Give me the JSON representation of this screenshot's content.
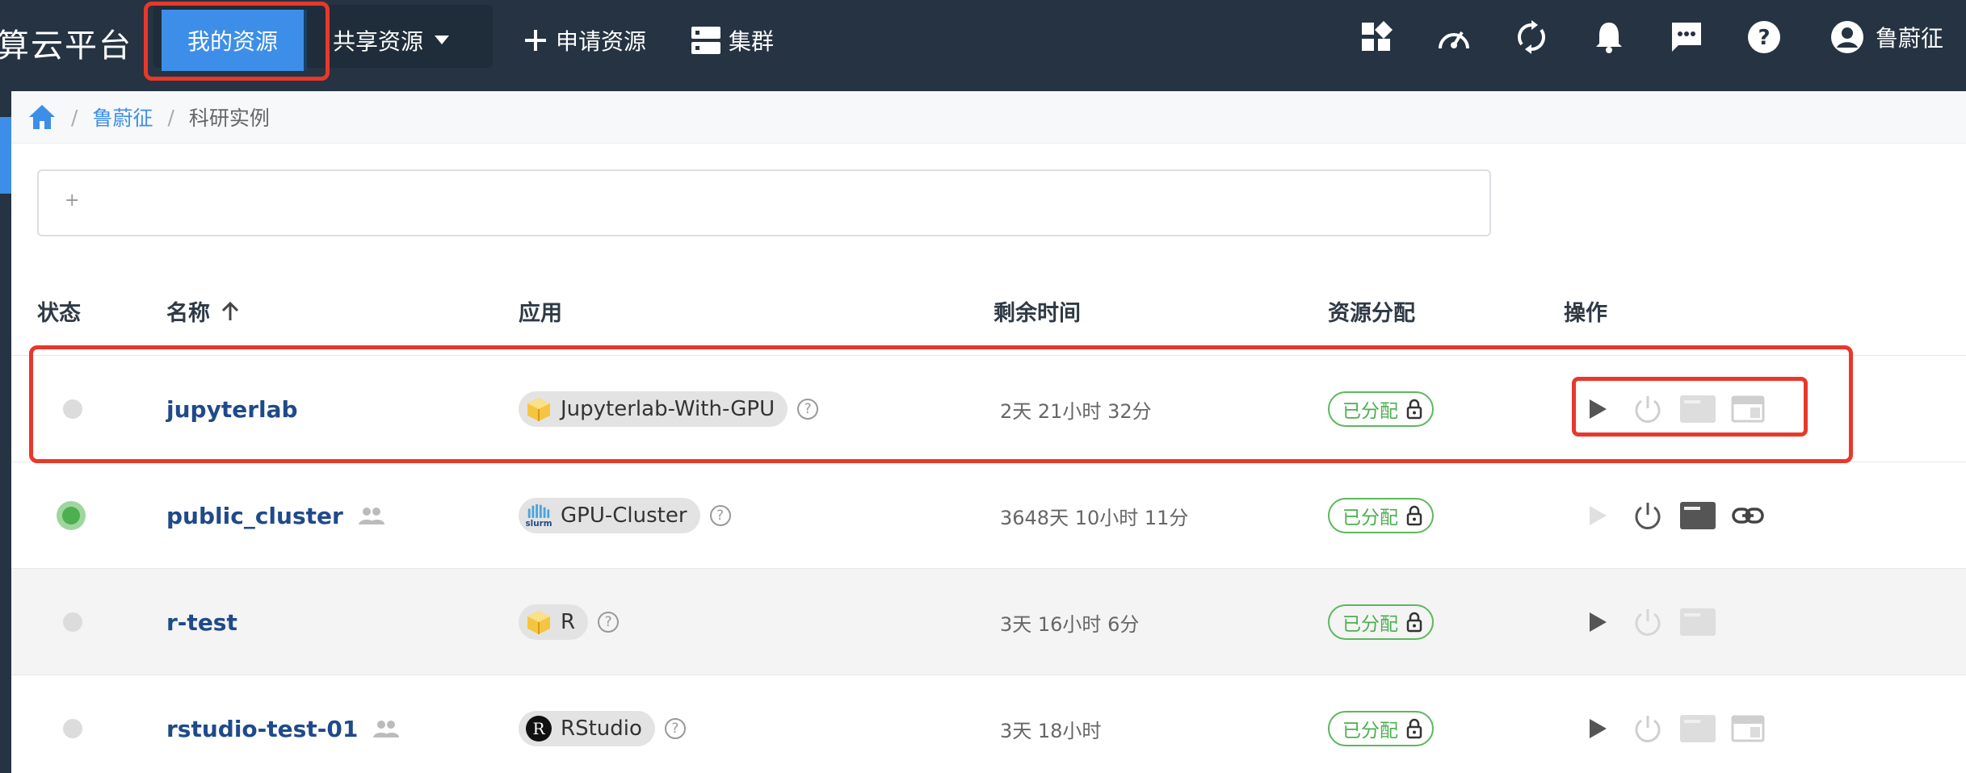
{
  "header": {
    "brand": "算云平台",
    "nav": {
      "my_resources": "我的资源",
      "shared_resources": "共享资源",
      "apply_resources": "申请资源",
      "cluster": "集群"
    },
    "user_name": "鲁蔚征",
    "icons": [
      "dashboard-icon",
      "speedometer-icon",
      "sync-icon",
      "bell-icon",
      "message-icon",
      "help-icon",
      "account-icon"
    ]
  },
  "breadcrumb": {
    "user": "鲁蔚征",
    "current": "科研实例"
  },
  "filter": {
    "placeholder": "+"
  },
  "table": {
    "columns": {
      "status": "状态",
      "name": "名称",
      "app": "应用",
      "remaining": "剩余时间",
      "allocation": "资源分配",
      "actions": "操作"
    },
    "rows": [
      {
        "name": "jupyterlab",
        "status": "stopped",
        "shared": false,
        "app": "Jupyterlab-With-GPU",
        "app_icon": "cube-icon",
        "remaining": "2天 21小时 32分",
        "allocation": "已分配"
      },
      {
        "name": "public_cluster",
        "status": "running",
        "shared": true,
        "app": "GPU-Cluster",
        "app_icon": "slurm-icon",
        "remaining": "3648天 10小时 11分",
        "allocation": "已分配"
      },
      {
        "name": "r-test",
        "status": "stopped",
        "shared": false,
        "app": "R",
        "app_icon": "cube-icon",
        "remaining": "3天 16小时 6分",
        "allocation": "已分配"
      },
      {
        "name": "rstudio-test-01",
        "status": "stopped",
        "shared": true,
        "app": "RStudio",
        "app_icon": "rstudio-icon",
        "remaining": "3天 18小时",
        "allocation": "已分配"
      }
    ]
  },
  "colors": {
    "topbar": "#253342",
    "accent": "#3d8ee8",
    "highlight": "#e8382b",
    "allocated": "#4caf50"
  }
}
